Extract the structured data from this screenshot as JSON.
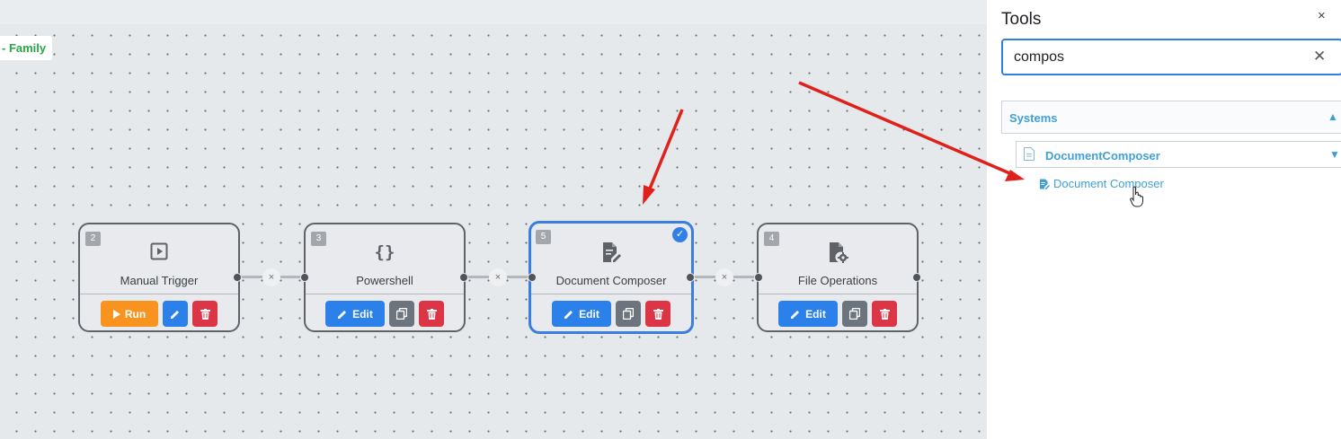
{
  "flow": {
    "label": "- Family"
  },
  "nodes": [
    {
      "number": "2",
      "title": "Manual Trigger",
      "icon": "play-square-icon",
      "run_label": "Run"
    },
    {
      "number": "3",
      "title": "Powershell",
      "icon": "braces-icon",
      "icon_glyph": "{}",
      "edit_label": "Edit"
    },
    {
      "number": "5",
      "title": "Document Composer",
      "icon": "document-edit-icon",
      "edit_label": "Edit",
      "selected": true
    },
    {
      "number": "4",
      "title": "File Operations",
      "icon": "file-gear-icon",
      "edit_label": "Edit"
    }
  ],
  "edges": {
    "remove_glyph": "×"
  },
  "panel": {
    "title": "Tools",
    "close_glyph": "×",
    "search": {
      "value": "compos",
      "clear_glyph": "✕"
    },
    "group": {
      "label": "Systems",
      "arrow": "▲"
    },
    "subgroup": {
      "label": "DocumentComposer",
      "arrow": "▼"
    },
    "tool": {
      "label": "Document Composer"
    }
  },
  "colors": {
    "accent": "#2f7fe6",
    "run": "#f7931e",
    "delete": "#dc3545",
    "copy": "#6c757d",
    "link": "#3fa0d8",
    "flow_label": "#28a745",
    "annotation": "#e0201b"
  }
}
